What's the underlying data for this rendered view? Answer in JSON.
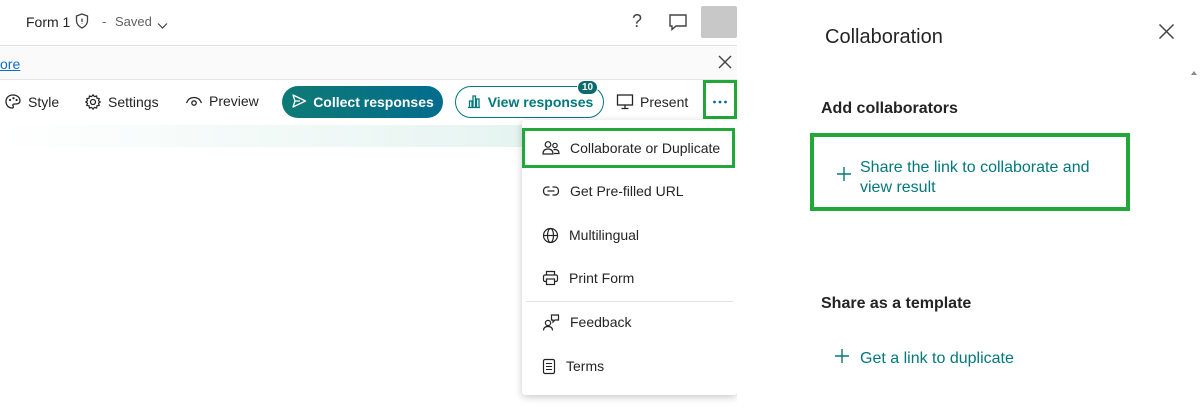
{
  "header": {
    "form_title": "Form 1",
    "separator": "-",
    "status": "Saved",
    "help_glyph": "?",
    "icons": [
      "shield-icon",
      "chevron-down-icon",
      "help-icon",
      "comment-icon",
      "avatar"
    ]
  },
  "notice": {
    "link_fragment": "ore"
  },
  "toolbar": {
    "style_label": "Style",
    "settings_label": "Settings",
    "preview_label": "Preview",
    "collect_label": "Collect responses",
    "view_label": "View responses",
    "view_count": "10",
    "present_label": "Present",
    "more_glyph": "···"
  },
  "more_menu": {
    "items": [
      {
        "label": "Collaborate or Duplicate",
        "icon": "people-icon"
      },
      {
        "label": "Get Pre-filled URL",
        "icon": "link-icon"
      },
      {
        "label": "Multilingual",
        "icon": "globe-icon"
      },
      {
        "label": "Print Form",
        "icon": "printer-icon"
      },
      {
        "label": "Feedback",
        "icon": "feedback-icon"
      },
      {
        "label": "Terms",
        "icon": "document-icon"
      }
    ]
  },
  "collab_pane": {
    "title": "Collaboration",
    "add_heading": "Add collaborators",
    "share_collab_label": "Share the link to collaborate and view result",
    "template_heading": "Share as a template",
    "duplicate_label": "Get a link to duplicate"
  },
  "colors": {
    "accent_teal": "#03787c",
    "annotation_green": "#22a83a",
    "link_blue": "#0f6cbd"
  }
}
